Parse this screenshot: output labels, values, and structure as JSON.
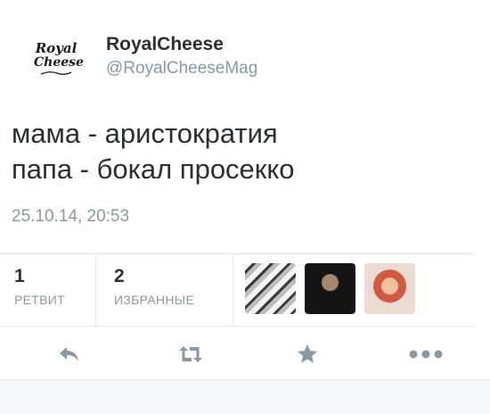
{
  "account": {
    "logo_line1": "Royal",
    "logo_line2": "Cheese",
    "name": "RoyalCheese",
    "handle": "@RoyalCheeseMag"
  },
  "tweet": {
    "lines": [
      "мама - аристократия",
      "папа - бокал просекко"
    ],
    "timestamp": "25.10.14, 20:53"
  },
  "stats": {
    "retweets": {
      "count": "1",
      "label": "РЕТВИТ"
    },
    "favorites": {
      "count": "2",
      "label": "ИЗБРАННЫЕ"
    }
  },
  "favoriters": [
    "avatar-1",
    "avatar-2",
    "avatar-3"
  ],
  "actions": [
    "reply-icon",
    "retweet-icon",
    "favorite-icon",
    "more-icon"
  ],
  "colors": {
    "text": "#292f33",
    "muted": "#8899a6",
    "divider": "#e1e8ed",
    "footer": "#f5f8fa"
  }
}
